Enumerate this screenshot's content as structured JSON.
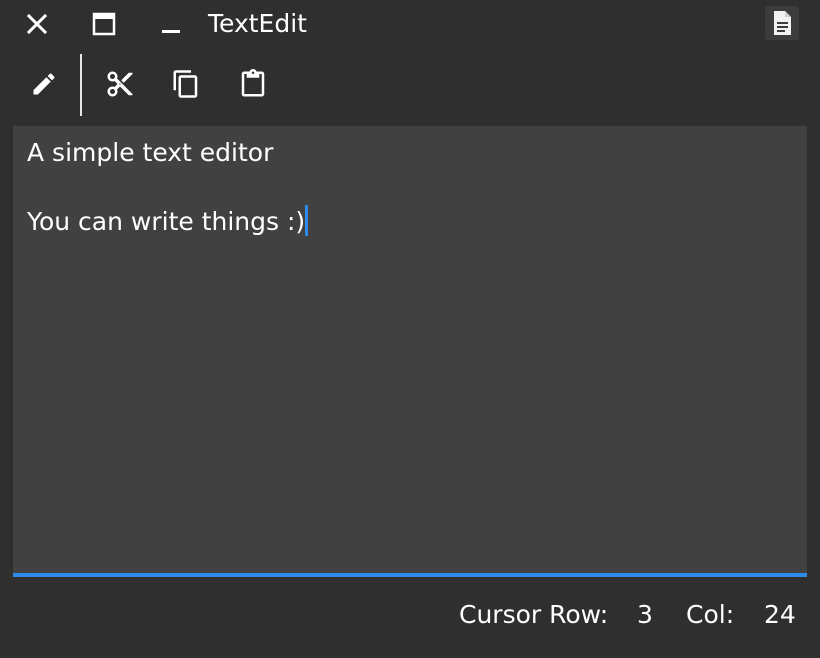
{
  "window": {
    "title": "TextEdit"
  },
  "titlebar": {
    "close_icon": "close-icon",
    "maximize_icon": "maximize-icon",
    "minimize_icon": "minimize-icon",
    "document_icon": "document-icon"
  },
  "toolbar": {
    "items": [
      {
        "name": "edit",
        "icon": "pencil-icon"
      },
      {
        "name": "cut",
        "icon": "scissors-icon"
      },
      {
        "name": "copy",
        "icon": "copy-icon"
      },
      {
        "name": "paste",
        "icon": "clipboard-icon"
      }
    ]
  },
  "editor": {
    "lines": [
      "A simple text editor",
      "",
      "You can write things :)"
    ]
  },
  "status": {
    "row_label": "Cursor Row:",
    "row_value": "3",
    "col_label": "Col:",
    "col_value": "24"
  },
  "colors": {
    "background": "#2f2f2f",
    "editor_background": "#414141",
    "accent": "#2d8ae6"
  }
}
